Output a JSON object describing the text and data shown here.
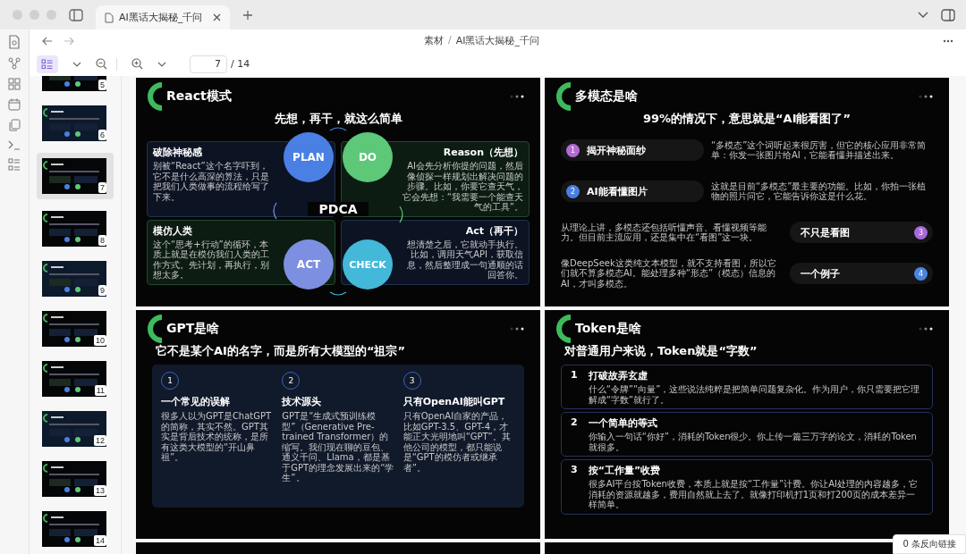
{
  "window": {
    "tab_title": "AI黑话大揭秘_千问"
  },
  "breadcrumb": {
    "parts": [
      "素材",
      "AI黑话大揭秘_千问"
    ],
    "separator": "/"
  },
  "toolbar": {
    "page": "7",
    "total": "/ 14"
  },
  "thumbnails": [
    {
      "number": "5",
      "selected": false
    },
    {
      "number": "6",
      "selected": false
    },
    {
      "number": "7",
      "selected": true
    },
    {
      "number": "8",
      "selected": false
    },
    {
      "number": "9",
      "selected": false
    },
    {
      "number": "10",
      "selected": false
    },
    {
      "number": "11",
      "selected": false
    },
    {
      "number": "12",
      "selected": false
    },
    {
      "number": "13",
      "selected": false
    },
    {
      "number": "14",
      "selected": false
    }
  ],
  "slides": [
    {
      "kind": "pdca",
      "title": "React模式",
      "subtitle": "先想，再干，就这么简单",
      "center": "PDCA",
      "cards": [
        {
          "title": "破除神秘感",
          "text": "别被“React”这个名字吓到，它不是什么高深的算法，只是把我们人类做事的流程给写了下来。"
        },
        {
          "title": "Reason（先想）",
          "text": "AI会先分析你提的问题，然后像侦探一样规划出解决问题的步骤。比如，你要它查天气，它会先想：“我需要一个能查天气的工具”。"
        },
        {
          "title": "模仿人类",
          "text": "这个“思考+行动”的循环，本质上就是在模仿我们人类的工作方式。先计划，再执行，别想太多。"
        },
        {
          "title": "Act（再干）",
          "text": "想清楚之后，它就动手执行。比如，调用天气API，获取信息，然后整理成一句通顺的话回答你。"
        }
      ],
      "circles": [
        {
          "label": "PLAN",
          "color": "#4a7fe4"
        },
        {
          "label": "DO",
          "color": "#5cc878"
        },
        {
          "label": "ACT",
          "color": "#7d8fe0"
        },
        {
          "label": "CHECK",
          "color": "#43b8d8"
        }
      ]
    },
    {
      "kind": "pills",
      "title": "多模态是啥",
      "subtitle": "99%的情况下，意思就是“AI能看图了”",
      "items": [
        {
          "number": "1",
          "label": "揭开神秘面纱",
          "kind": "pill-first",
          "color": "#b46ad4",
          "text": "“多模态”这个词听起来很厉害，但它的核心应用非常简单：你发一张图片给AI，它能看懂并描述出来。"
        },
        {
          "number": "2",
          "label": "AI能看懂图片",
          "kind": "pill-first",
          "color": "#4a7fe0",
          "text": "这就是目前“多模态”最主要的功能。比如，你拍一张植物的照片问它，它能告诉你这是什么花。"
        },
        {
          "number": "3",
          "label": "不只是看图",
          "kind": "text-first",
          "color": "#a86ad8",
          "text": "从理论上讲，多模态还包括听懂声音、看懂视频等能力。但目前主流应用，还是集中在“看图”这一块。"
        },
        {
          "number": "4",
          "label": "一个例子",
          "kind": "text-first",
          "color": "#4a86e0",
          "text": "像DeepSeek这类纯文本模型，就不支持看图，所以它们就不算多模态AI。能处理多种“形态”（模态）信息的AI，才叫多模态。"
        }
      ]
    },
    {
      "kind": "columns",
      "title": "GPT是啥",
      "subtitle": "它不是某个AI的名字，而是所有大模型的“祖宗”",
      "items": [
        {
          "number": "1",
          "title": "一个常见的误解",
          "text": "很多人以为GPT是ChatGPT的简称，其实不然。GPT其实是背后技术的统称，是所有这类大模型的“开山鼻祖”。"
        },
        {
          "number": "2",
          "title": "技术源头",
          "text": "GPT是“生成式预训练模型”（Generative Pre-trained Transformer）的缩写。我们现在聊的豆包、通义千问、Llama，都是基于GPT的理念发展出来的“学生”。"
        },
        {
          "number": "3",
          "title": "只有OpenAI能叫GPT",
          "text": "只有OpenAI自家的产品，比如GPT-3.5、GPT-4，才能正大光明地叫“GPT”。其他公司的模型，都只能说是“GPT的模仿者或继承者”。"
        }
      ]
    },
    {
      "kind": "numbered",
      "title": "Token是啥",
      "subtitle": "对普通用户来说，Token就是“字数”",
      "items": [
        {
          "number": "1",
          "title": "打破故弄玄虚",
          "text": "什么“令牌”“向量”，这些说法纯粹是把简单问题复杂化。作为用户，你只需要把它理解成“字数”就行了。"
        },
        {
          "number": "2",
          "title": "一个简单的等式",
          "text": "你输入一句话“你好”，消耗的Token很少。你上传一篇三万字的论文，消耗的Token就很多。"
        },
        {
          "number": "3",
          "title": "按“工作量”收费",
          "text": "很多AI平台按Token收费，本质上就是按“工作量”计费。你让AI处理的内容越多，它消耗的资源就越多，费用自然就上去了。就像打印机打1页和打200页的成本差异一样简单。"
        }
      ]
    }
  ],
  "backlinks": "0 条反向链接"
}
